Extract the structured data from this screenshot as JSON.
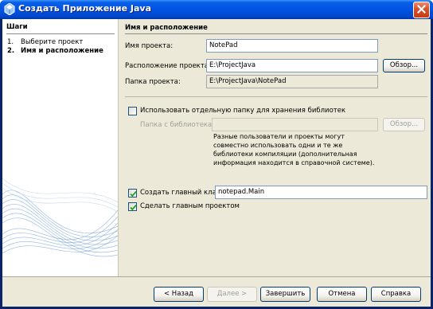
{
  "window": {
    "title": "Создать Приложение Java"
  },
  "steps": {
    "heading": "Шаги",
    "items": [
      {
        "num": "1.",
        "label": "Выберите проект"
      },
      {
        "num": "2.",
        "label": "Имя и расположение"
      }
    ]
  },
  "form": {
    "heading": "Имя и расположение",
    "project_name_label": "Имя проекта:",
    "project_name_value": "NotePad",
    "location_label": "Расположение проекта:",
    "location_value": "E:\\ProjectJava",
    "browse_label": "Обзор...",
    "folder_label": "Папка проекта:",
    "folder_value": "E:\\ProjectJava\\NotePad",
    "separate_libs_label": "Использовать отдельную папку для хранения библиотек",
    "separate_libs_checked": false,
    "libs_folder_label": "Папка с библиотеками:",
    "libs_folder_value": "",
    "libs_browse_label": "Обзор...",
    "libs_note": "Разные пользователи и проекты могут совместно использовать одни и те же библиотеки компиляции (дополнительная информация находится в справочной системе).",
    "main_class_label": "Создать главный класс",
    "main_class_checked": true,
    "main_class_value": "notepad.Main",
    "main_project_label": "Сделать главным проектом",
    "main_project_checked": true
  },
  "buttons": {
    "back": "< Назад",
    "next": "Далее >",
    "finish": "Завершить",
    "cancel": "Отмена",
    "help": "Справка"
  }
}
